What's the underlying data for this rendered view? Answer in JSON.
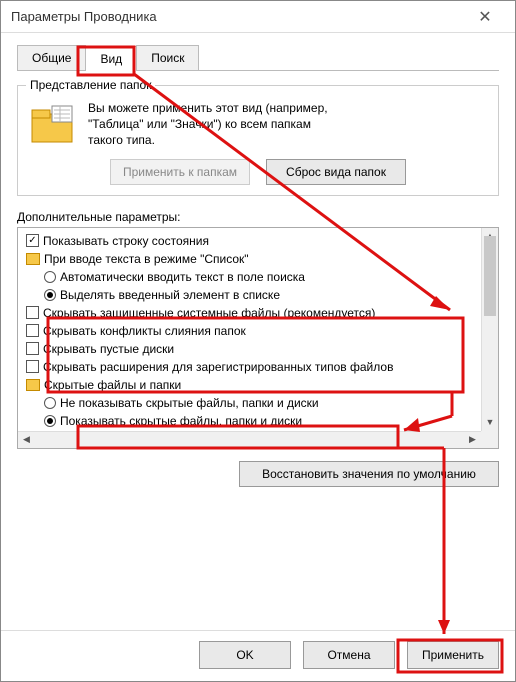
{
  "window": {
    "title": "Параметры Проводника"
  },
  "tabs": {
    "general": "Общие",
    "view": "Вид",
    "search": "Поиск"
  },
  "folderView": {
    "group_title": "Представление папок",
    "desc1": "Вы можете применить этот вид (например,",
    "desc2": "\"Таблица\" или \"Значки\") ко всем папкам",
    "desc3": "такого типа.",
    "apply_btn": "Применить к папкам",
    "reset_btn": "Сброс вида папок"
  },
  "advanced": {
    "label": "Дополнительные параметры:",
    "items": [
      {
        "type": "checkbox",
        "level": 1,
        "checked": true,
        "label": "Показывать строку состояния"
      },
      {
        "type": "folder",
        "level": 1,
        "label": "При вводе текста в режиме \"Список\""
      },
      {
        "type": "radio",
        "level": 2,
        "selected": false,
        "label": "Автоматически вводить текст в поле поиска"
      },
      {
        "type": "radio",
        "level": 2,
        "selected": true,
        "label": "Выделять введенный элемент в списке"
      },
      {
        "type": "checkbox",
        "level": 1,
        "checked": false,
        "label": "Скрывать защищенные системные файлы (рекомендуется)"
      },
      {
        "type": "checkbox",
        "level": 1,
        "checked": false,
        "label": "Скрывать конфликты слияния папок"
      },
      {
        "type": "checkbox",
        "level": 1,
        "checked": false,
        "label": "Скрывать пустые диски"
      },
      {
        "type": "checkbox",
        "level": 1,
        "checked": false,
        "label": "Скрывать расширения для зарегистрированных типов файлов"
      },
      {
        "type": "folder",
        "level": 1,
        "label": "Скрытые файлы и папки"
      },
      {
        "type": "radio",
        "level": 2,
        "selected": false,
        "label": "Не показывать скрытые файлы, папки и диски"
      },
      {
        "type": "radio",
        "level": 2,
        "selected": true,
        "label": "Показывать скрытые файлы, папки и диски"
      }
    ],
    "restore_btn": "Восстановить значения по умолчанию"
  },
  "footer": {
    "ok": "OK",
    "cancel": "Отмена",
    "apply": "Применить"
  }
}
